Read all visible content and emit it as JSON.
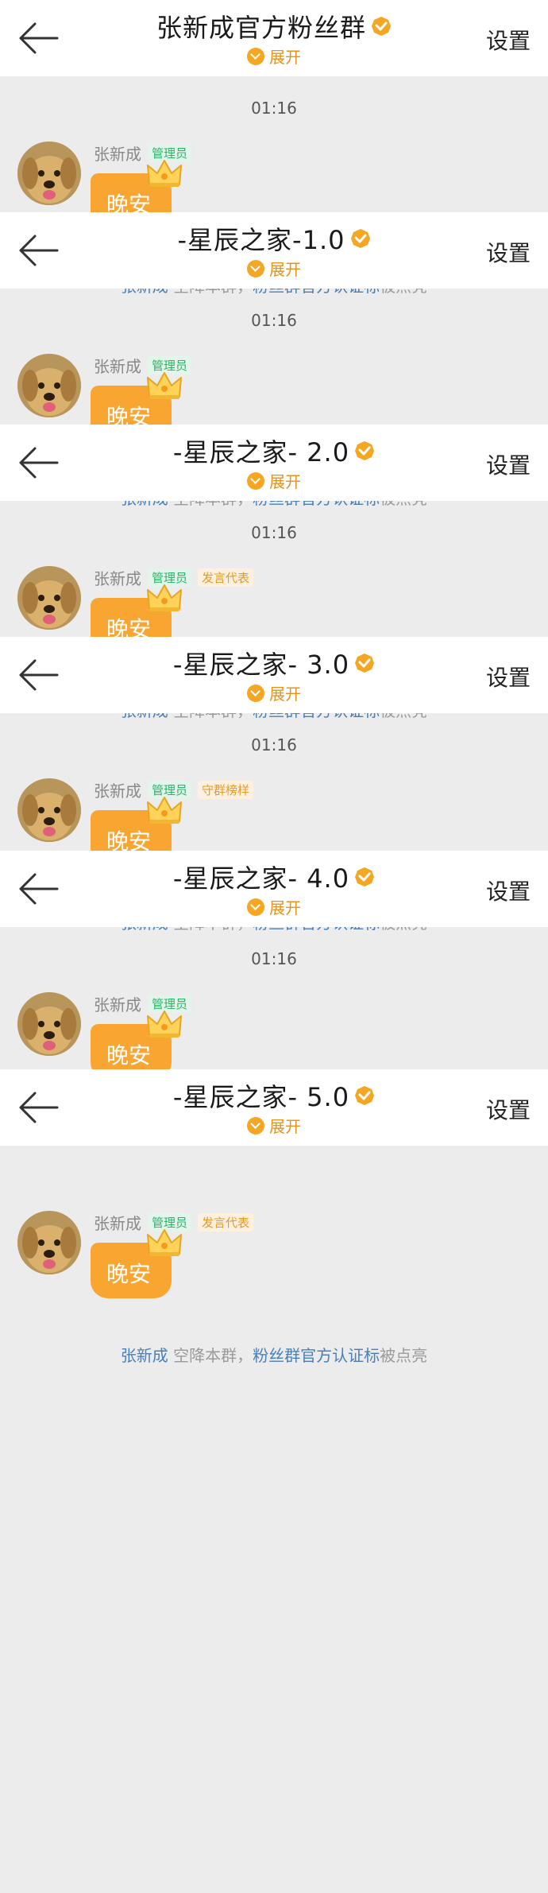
{
  "panels": [
    {
      "title": "张新成官方粉丝群",
      "expand": "展开",
      "settings": "设置",
      "time": "01:16",
      "sender": "张新成",
      "tags": [
        "管理员"
      ],
      "message": "晚安",
      "system": {
        "user": "张新成",
        "action": " 空降本群，",
        "badge": "粉丝群官方认证标",
        "suffix": "被点亮"
      }
    },
    {
      "title": "-星辰之家-1.0",
      "expand": "展开",
      "settings": "设置",
      "time": "01:16",
      "sender": "张新成",
      "tags": [
        "管理员"
      ],
      "message": "晚安",
      "system": {
        "user": "张新成",
        "action": " 空降本群，",
        "badge": "粉丝群官方认证标",
        "suffix": "被点亮"
      }
    },
    {
      "title": "-星辰之家- 2.0",
      "expand": "展开",
      "settings": "设置",
      "time": "01:16",
      "sender": "张新成",
      "tags": [
        "管理员",
        "发言代表"
      ],
      "message": "晚安",
      "system": {
        "user": "张新成",
        "action": " 空降本群，",
        "badge": "粉丝群官方认证标",
        "suffix": "被点亮"
      }
    },
    {
      "title": "-星辰之家- 3.0",
      "expand": "展开",
      "settings": "设置",
      "time": "01:16",
      "sender": "张新成",
      "tags": [
        "管理员",
        "守群榜样"
      ],
      "message": "晚安",
      "system": {
        "user": "张新成",
        "action": " 空降本群，",
        "badge": "粉丝群官方认证标",
        "suffix": "被点亮"
      }
    },
    {
      "title": "-星辰之家- 4.0",
      "expand": "展开",
      "settings": "设置",
      "time": "01:16",
      "sender": "张新成",
      "tags": [
        "管理员"
      ],
      "message": "晚安",
      "system": {
        "user": "张新成",
        "action": " 空降本群，",
        "badge": "粉丝群官方认证标",
        "suffix": "被点亮"
      }
    },
    {
      "title": "-星辰之家- 5.0",
      "expand": "展开",
      "settings": "设置",
      "time": "",
      "sender": "张新成",
      "tags": [
        "管理员",
        "发言代表"
      ],
      "message": "晚安",
      "system": {
        "user": "张新成",
        "action": " 空降本群，",
        "badge": "粉丝群官方认证标",
        "suffix": "被点亮"
      }
    }
  ],
  "icons": {
    "back": "back-arrow-icon",
    "verified": "verified-badge-icon",
    "expand": "expand-chevron-icon",
    "crown": "crown-icon",
    "avatar": "dog-avatar-image"
  },
  "colors": {
    "accent": "#f5a623",
    "bubble": "#f9a531",
    "link": "#4a7fb5",
    "admin_tag": "#2fb36b",
    "rep_tag": "#e59a2a"
  }
}
